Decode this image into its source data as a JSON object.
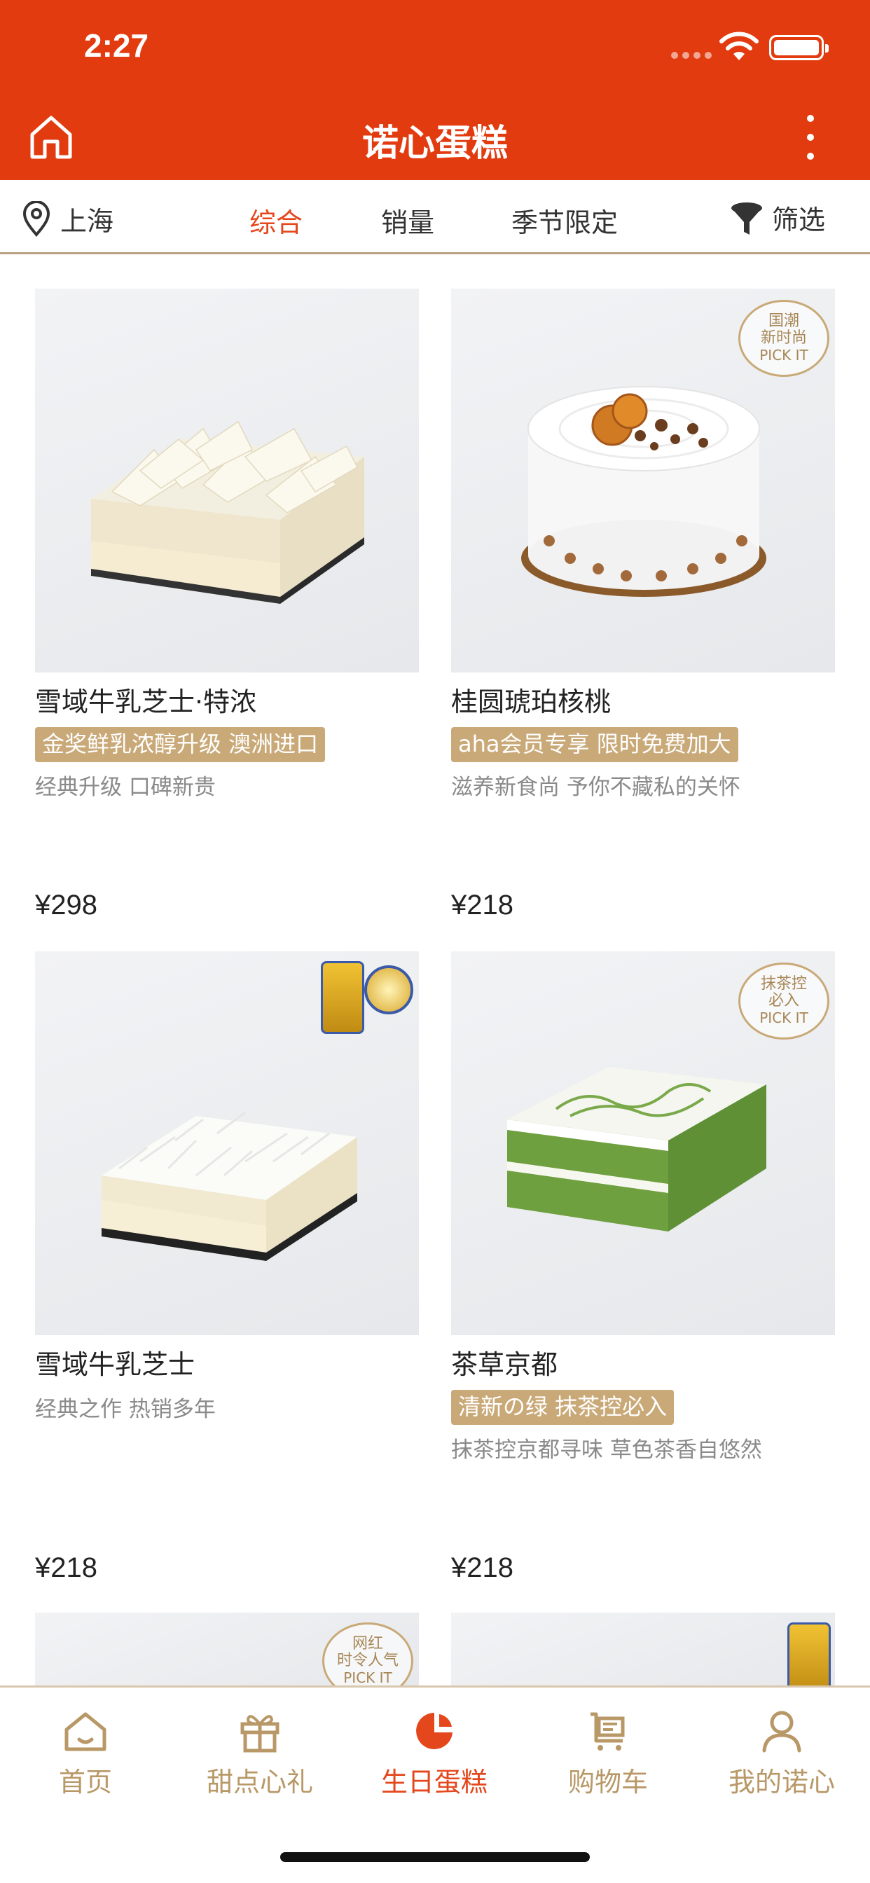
{
  "status_bar": {
    "time": "2:27"
  },
  "header": {
    "title": "诺心蛋糕"
  },
  "filter_bar": {
    "location": "上海",
    "tabs": [
      {
        "label": "综合",
        "active": true
      },
      {
        "label": "销量",
        "active": false
      },
      {
        "label": "季节限定",
        "active": false
      }
    ],
    "filter_label": "筛选"
  },
  "products": [
    {
      "name": "雪域牛乳芝士·特浓",
      "tag": "金奖鲜乳浓醇升级 澳洲进口",
      "desc": "经典升级 口碑新贵",
      "price": "¥298"
    },
    {
      "name": "桂圆琥珀核桃",
      "tag": "aha会员专享 限时免费加大",
      "desc": "滋养新食尚 予你不藏私的关怀",
      "price": "¥218",
      "badge": [
        "国潮",
        "新时尚",
        "PICK IT"
      ]
    },
    {
      "name": "雪域牛乳芝士",
      "tag": "",
      "desc": "经典之作 热销多年",
      "price": "¥218"
    },
    {
      "name": "茶草京都",
      "tag": "清新の绿 抹茶控必入",
      "desc": "抹茶控京都寻味 草色茶香自悠然",
      "price": "¥218",
      "badge": [
        "抹茶控",
        "必入",
        "PICK IT"
      ]
    },
    {
      "badge": [
        "网红",
        "时令人气",
        "PICK IT"
      ]
    },
    {}
  ],
  "tabbar": {
    "items": [
      {
        "label": "首页",
        "icon": "home-outline-icon",
        "active": false
      },
      {
        "label": "甜点心礼",
        "icon": "gift-icon",
        "active": false
      },
      {
        "label": "生日蛋糕",
        "icon": "cake-icon",
        "active": true
      },
      {
        "label": "购物车",
        "icon": "cart-icon",
        "active": false
      },
      {
        "label": "我的诺心",
        "icon": "user-icon",
        "active": false
      }
    ]
  },
  "colors": {
    "brand": "#e23b10",
    "accent": "#e5471c",
    "gold": "#c9a978"
  }
}
